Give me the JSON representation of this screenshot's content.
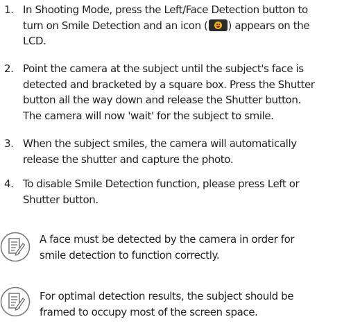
{
  "steps": [
    {
      "number": "1.",
      "lines": [
        "In Shooting Mode, press the Left/Face Detection button to",
        "turn on Smile Detection and an icon (",
        ") appears on the",
        "LCD."
      ]
    },
    {
      "number": "2.",
      "lines": [
        "Point the camera at the subject until the subject's face is",
        "detected and bracketed by a square box. Press the Shutter",
        "button all the way down and release the Shutter button.",
        "The camera will now 'wait' for the subject to smile."
      ]
    },
    {
      "number": "3.",
      "lines": [
        "When the subject smiles, the camera will automatically",
        "release the shutter and capture the photo."
      ]
    },
    {
      "number": "4.",
      "lines": [
        "To disable Smile Detection function, please press Left or",
        "Shutter button."
      ]
    }
  ],
  "notes": [
    {
      "icon": "note-icon",
      "lines": [
        "A face must be detected by the camera in order for",
        "smile detection to function correctly."
      ]
    },
    {
      "icon": "note-icon",
      "lines": [
        "For optimal detection results, the subject should be",
        "framed to occupy most of the screen space."
      ]
    }
  ],
  "inline_icon": "smile-detection-icon",
  "colors": {
    "text": "#231f20",
    "icon_yellow": "#f2b21b",
    "icon_bg": "#2b2b2b"
  }
}
